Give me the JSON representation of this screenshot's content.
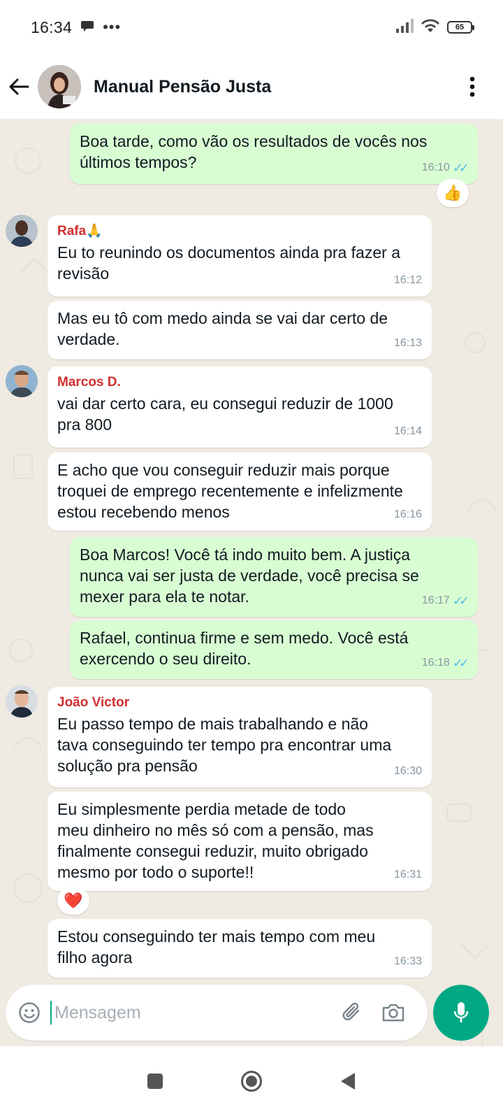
{
  "status_bar": {
    "time": "16:34",
    "battery": "65"
  },
  "header": {
    "title": "Manual Pensão Justa"
  },
  "messages": [
    {
      "type": "out",
      "text": "Boa tarde, como vão os resultados de vocês nos\núltimos tempos?",
      "time": "16:10",
      "reaction": "👍"
    },
    {
      "type": "in",
      "sender": "Rafa🙏",
      "text": "Eu to reunindo os documentos ainda pra fazer a\nrevisão",
      "time": "16:12"
    },
    {
      "type": "in",
      "text": "Mas eu tô  com medo ainda se vai dar certo de\nverdade.",
      "time": "16:13"
    },
    {
      "type": "in",
      "sender": "Marcos D.",
      "text": "vai dar certo cara, eu consegui reduzir de 1000\npra 800",
      "time": "16:14"
    },
    {
      "type": "in",
      "text": "E acho que vou conseguir reduzir mais porque\ntroquei de emprego recentemente e infelizmente\nestou recebendo menos",
      "time": "16:16"
    },
    {
      "type": "out",
      "text": "Boa Marcos! Você tá indo muito bem. A justiça\nnunca vai ser justa de verdade, você precisa se\nmexer para ela te notar.",
      "time": "16:17"
    },
    {
      "type": "out",
      "text": "Rafael, continua firme e sem medo. Você está\nexercendo o seu direito.",
      "time": "16:18"
    },
    {
      "type": "in",
      "sender": "João Victor",
      "text": "Eu passo tempo de mais trabalhando e não\ntava conseguindo ter tempo pra encontrar uma\nsolução pra pensão",
      "time": "16:30"
    },
    {
      "type": "in",
      "text": "Eu simplesmente perdia metade de todo\nmeu dinheiro no mês só com a pensão, mas\nfinalmente consegui reduzir, muito obrigado\nmesmo por todo o suporte!!",
      "time": "16:31",
      "reaction": "❤️"
    },
    {
      "type": "in",
      "text": "Estou conseguindo ter mais tempo com meu\nfilho agora",
      "time": "16:33"
    }
  ],
  "input": {
    "placeholder": "Mensagem"
  },
  "colors": {
    "accent": "#00a884",
    "outgoing": "#d9fdd3",
    "incoming": "#ffffff",
    "sender": "#d32f2f",
    "ticks": "#53bdeb"
  }
}
